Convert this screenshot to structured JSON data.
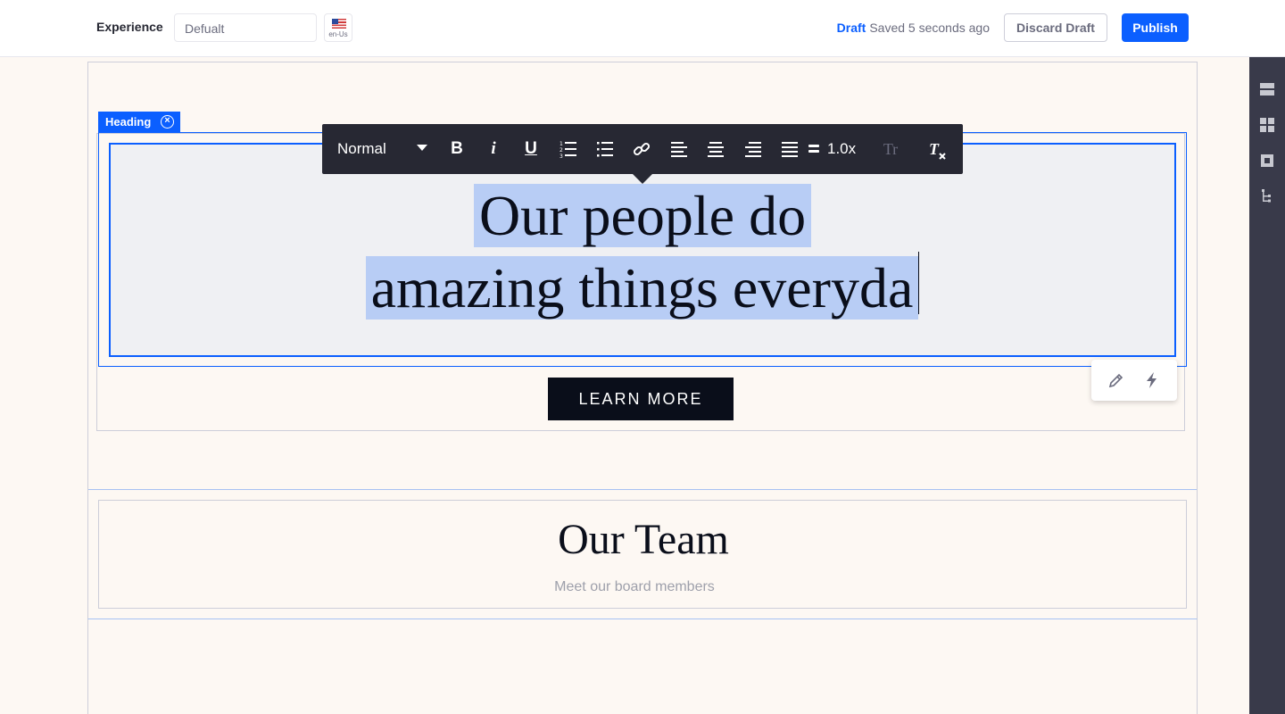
{
  "header": {
    "experience_label": "Experience",
    "experience_value": "Defualt",
    "locale_code": "en-Us",
    "draft_word": "Draft",
    "saved_status": "Saved 5 seconds ago",
    "discard_label": "Discard Draft",
    "publish_label": "Publish"
  },
  "sidebar": {
    "icons": [
      "section-builder-icon",
      "widgets-icon",
      "page-structure-icon",
      "tree-icon"
    ]
  },
  "fragment": {
    "tag_label": "Heading",
    "heading_line1": "Our people do",
    "heading_line2": "amazing things everyda",
    "button_label": "LEARN MORE"
  },
  "toolbar": {
    "style_value": "Normal",
    "line_height": "1.0x",
    "buttons": [
      "bold-icon",
      "italic-icon",
      "underline-icon",
      "ordered-list-icon",
      "bulleted-list-icon",
      "link-icon",
      "align-left-icon",
      "align-center-icon",
      "align-right-icon",
      "justify-icon",
      "line-height-icon",
      "text-style-icon",
      "clear-format-icon"
    ]
  },
  "team": {
    "title": "Our Team",
    "subtitle": "Meet our board members"
  },
  "colors": {
    "accent": "#0b5fff",
    "canvas": "#fdf8f3",
    "toolbar": "#272833",
    "sidebar": "#393a4a"
  }
}
